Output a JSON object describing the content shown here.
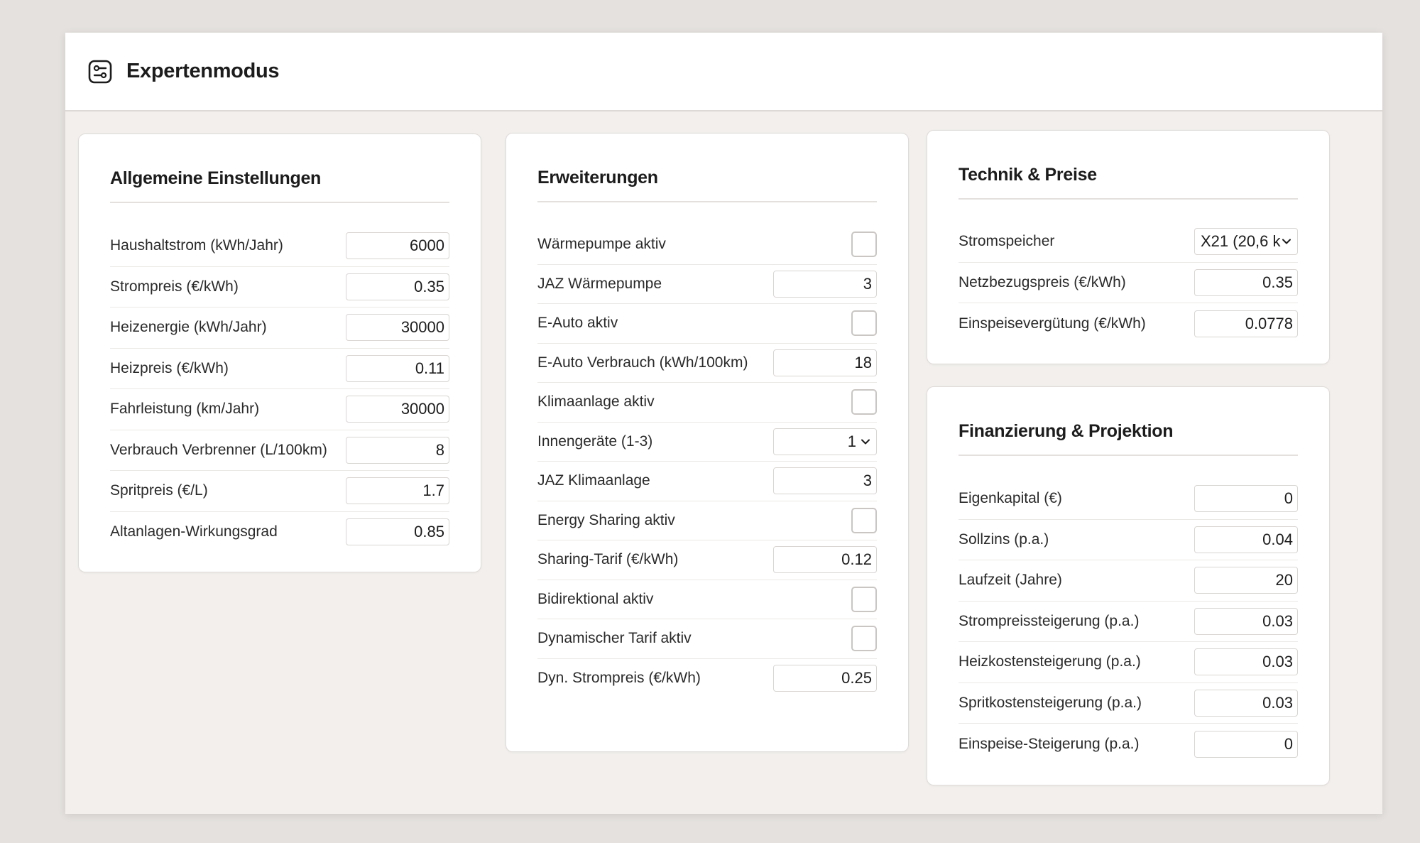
{
  "header": {
    "title": "Expertenmodus",
    "icon": "settings-toggle-icon"
  },
  "general": {
    "title": "Allgemeine Einstellungen",
    "rows": [
      {
        "label": "Haushaltstrom (kWh/Jahr)",
        "value": "6000"
      },
      {
        "label": "Strompreis (€/kWh)",
        "value": "0.35"
      },
      {
        "label": "Heizenergie (kWh/Jahr)",
        "value": "30000"
      },
      {
        "label": "Heizpreis (€/kWh)",
        "value": "0.11"
      },
      {
        "label": "Fahrleistung (km/Jahr)",
        "value": "30000"
      },
      {
        "label": "Verbrauch Verbrenner (L/100km)",
        "value": "8"
      },
      {
        "label": "Spritpreis (€/L)",
        "value": "1.7"
      },
      {
        "label": "Altanlagen-Wirkungsgrad",
        "value": "0.85"
      }
    ]
  },
  "extensions": {
    "title": "Erweiterungen",
    "rows": [
      {
        "label": "Wärmepumpe aktiv",
        "checked": false
      },
      {
        "label": "JAZ Wärmepumpe",
        "value": "3"
      },
      {
        "label": "E-Auto aktiv",
        "checked": false
      },
      {
        "label": "E-Auto Verbrauch (kWh/100km)",
        "value": "18"
      },
      {
        "label": "Klimaanlage aktiv",
        "checked": false
      },
      {
        "label": "Innengeräte (1-3)",
        "selected": "1"
      },
      {
        "label": "JAZ Klimaanlage",
        "value": "3"
      },
      {
        "label": "Energy Sharing aktiv",
        "checked": false
      },
      {
        "label": "Sharing-Tarif (€/kWh)",
        "value": "0.12"
      },
      {
        "label": "Bidirektional aktiv",
        "checked": false
      },
      {
        "label": "Dynamischer Tarif aktiv",
        "checked": false
      },
      {
        "label": "Dyn. Strompreis (€/kWh)",
        "value": "0.25"
      }
    ]
  },
  "tech": {
    "title": "Technik & Preise",
    "rows": [
      {
        "label": "Stromspeicher",
        "selected": "X21 (20,6 k"
      },
      {
        "label": "Netzbezugspreis (€/kWh)",
        "value": "0.35"
      },
      {
        "label": "Einspeisevergütung (€/kWh)",
        "value": "0.0778"
      }
    ]
  },
  "finance": {
    "title": "Finanzierung & Projektion",
    "rows": [
      {
        "label": "Eigenkapital (€)",
        "value": "0"
      },
      {
        "label": "Sollzins (p.a.)",
        "value": "0.04"
      },
      {
        "label": "Laufzeit (Jahre)",
        "value": "20"
      },
      {
        "label": "Strompreissteigerung (p.a.)",
        "value": "0.03"
      },
      {
        "label": "Heizkostensteigerung (p.a.)",
        "value": "0.03"
      },
      {
        "label": "Spritkostensteigerung (p.a.)",
        "value": "0.03"
      },
      {
        "label": "Einspeise-Steigerung (p.a.)",
        "value": "0"
      }
    ]
  }
}
